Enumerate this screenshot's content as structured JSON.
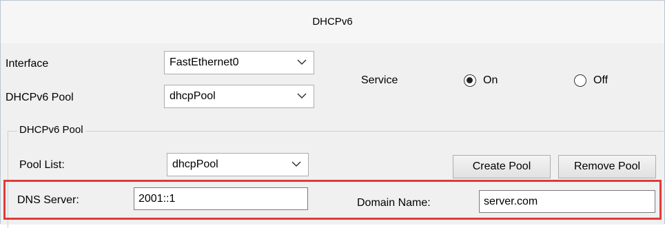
{
  "window": {
    "title": "DHCPv6"
  },
  "form": {
    "interface_label": "Interface",
    "interface_value": "FastEthernet0",
    "pool_label": "DHCPv6 Pool",
    "pool_value": "dhcpPool",
    "service_label": "Service",
    "service_on_label": "On",
    "service_off_label": "Off",
    "service_selected": "On"
  },
  "pool_group": {
    "legend": "DHCPv6 Pool",
    "pool_list_label": "Pool List:",
    "pool_list_value": "dhcpPool",
    "create_label": "Create Pool",
    "remove_label": "Remove Pool",
    "dns_label": "DNS Server:",
    "dns_value": "2001::1",
    "domain_label": "Domain Name:",
    "domain_value": "server.com"
  },
  "icons": {
    "dropdown": "chevron-down-icon",
    "radio_selected": "radio-selected-icon",
    "radio_unselected": "radio-unselected-icon"
  },
  "colors": {
    "highlight_border": "#e03a3a",
    "panel_bg": "#f0f0f0",
    "title_bg": "#f6f6f6"
  }
}
